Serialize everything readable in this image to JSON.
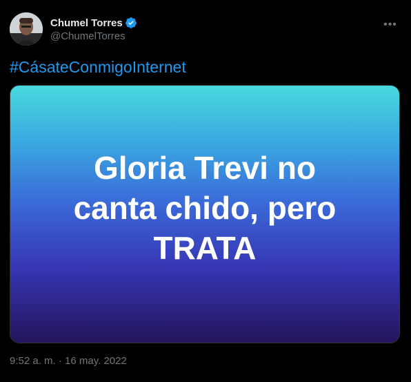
{
  "author": {
    "display_name": "Chumel Torres",
    "handle": "@ChumelTorres",
    "verified": true,
    "verified_color": "#1d9bf0",
    "avatar_icon": "avatar-photo"
  },
  "tweet": {
    "hashtag": "#CásateConmigoInternet",
    "media": {
      "line1": "Gloria Trevi no",
      "line2": "canta chido, pero",
      "line3": "TRATA"
    },
    "timestamp": "9:52 a. m. · 16 may. 2022"
  },
  "actions": {
    "more_icon": "more-icon"
  },
  "colors": {
    "background": "#000000",
    "link": "#1d9bf0",
    "muted": "#71767b"
  }
}
